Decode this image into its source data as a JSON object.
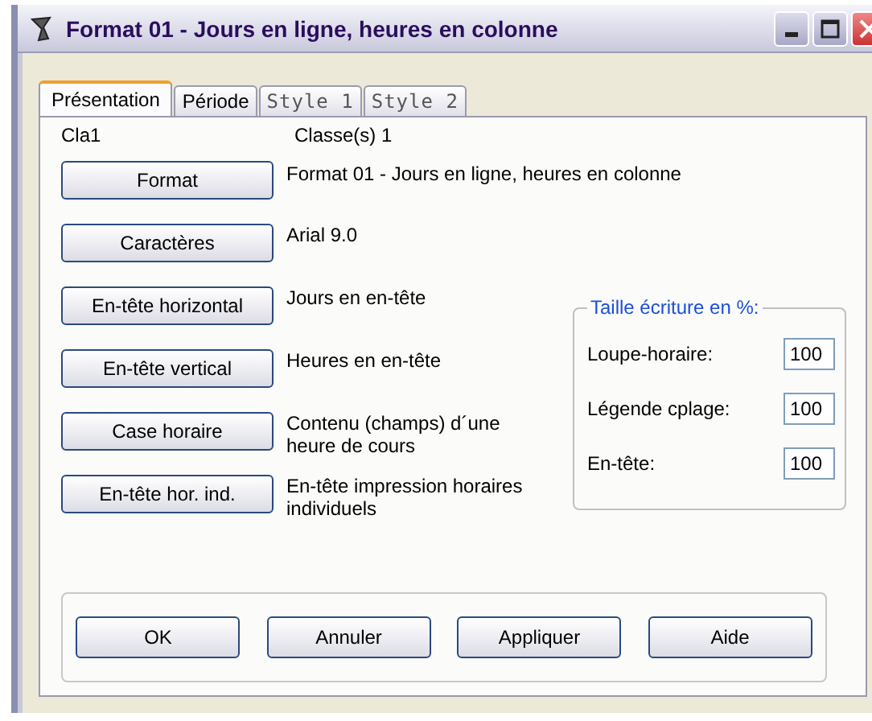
{
  "window": {
    "title": "Format 01 - Jours en ligne, heures en colonne"
  },
  "tabs": [
    {
      "label": "Présentation",
      "selected": true
    },
    {
      "label": "Période",
      "selected": false
    },
    {
      "label": "Style 1",
      "selected": false
    },
    {
      "label": "Style 2",
      "selected": false
    }
  ],
  "header": {
    "code": "Cla1",
    "classes": "Classe(s) 1"
  },
  "rows": [
    {
      "button": "Format",
      "description": "Format 01 - Jours en ligne, heures en colonne"
    },
    {
      "button": "Caractères",
      "description": "Arial 9.0"
    },
    {
      "button": "En-tête horizontal",
      "description": "Jours en en-tête"
    },
    {
      "button": "En-tête vertical",
      "description": "Heures en en-tête"
    },
    {
      "button": "Case horaire",
      "description": "Contenu (champs) d´une heure de cours"
    },
    {
      "button": "En-tête hor. ind.",
      "description": "En-tête impression horaires individuels"
    }
  ],
  "size_group": {
    "title": "Taille écriture en %:",
    "fields": [
      {
        "label": "Loupe-horaire:",
        "value": "100"
      },
      {
        "label": "Légende cplage:",
        "value": "100"
      },
      {
        "label": "En-tête:",
        "value": "100"
      }
    ]
  },
  "buttons": [
    "OK",
    "Annuler",
    "Appliquer",
    "Aide"
  ]
}
